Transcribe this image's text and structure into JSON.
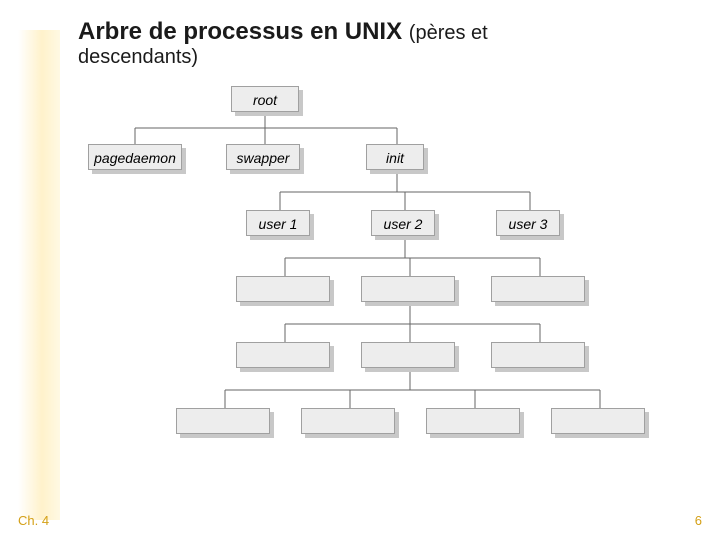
{
  "title_main": "Arbre de processus en UNIX",
  "title_paren": "(pères et",
  "title_line2": "descendants)",
  "chapter": "Ch. 4",
  "page": "6",
  "nodes": {
    "root": "root",
    "pagedaemon": "pagedaemon",
    "swapper": "swapper",
    "init": "init",
    "user1": "user 1",
    "user2": "user 2",
    "user3": "user 3",
    "e31": "",
    "e32": "",
    "e33": "",
    "e41": "",
    "e42": "",
    "e43": "",
    "e51": "",
    "e52": "",
    "e53": "",
    "e54": ""
  }
}
